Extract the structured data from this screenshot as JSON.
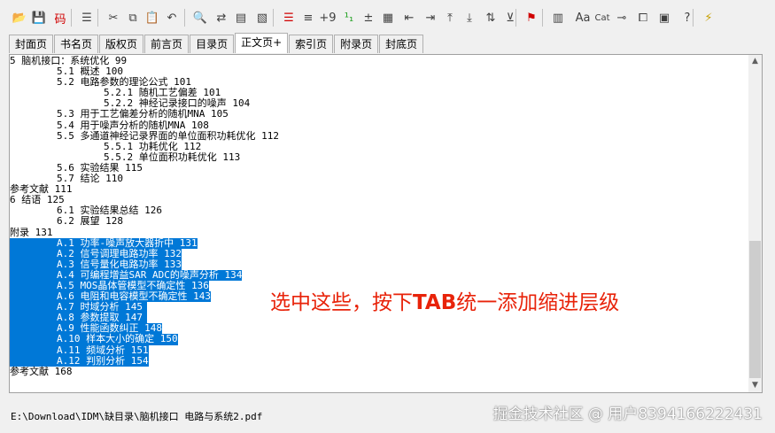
{
  "toolbar": {
    "items": [
      {
        "name": "open-folder-icon",
        "glyph": "📂",
        "color": "#c89a00"
      },
      {
        "name": "save-icon",
        "glyph": "💾",
        "color": "#404040"
      },
      {
        "name": "encoding-icon",
        "glyph": "码",
        "color": "#d00000"
      },
      {
        "name": "bookmark-panel-icon",
        "glyph": "☰",
        "color": "#404040"
      },
      {
        "name": "cut-icon",
        "glyph": "✂",
        "color": "#404040"
      },
      {
        "name": "copy-icon",
        "glyph": "⧉",
        "color": "#404040"
      },
      {
        "name": "paste-icon",
        "glyph": "📋",
        "color": "#404040"
      },
      {
        "name": "undo-icon",
        "glyph": "↶",
        "color": "#404040"
      },
      {
        "name": "find-icon",
        "glyph": "🔍",
        "color": "#404040"
      },
      {
        "name": "replace-icon",
        "glyph": "⇄",
        "color": "#404040"
      },
      {
        "name": "page-icon",
        "glyph": "▤",
        "color": "#404040"
      },
      {
        "name": "page-find-icon",
        "glyph": "▧",
        "color": "#404040"
      },
      {
        "name": "indent-level-icon",
        "glyph": "☰",
        "color": "#d00000"
      },
      {
        "name": "align-icon",
        "glyph": "≡",
        "color": "#404040"
      },
      {
        "name": "offset-icon",
        "glyph": "+9",
        "color": "#404040"
      },
      {
        "name": "numbering-icon",
        "glyph": "¹₁",
        "color": "#20a020"
      },
      {
        "name": "plus-minus-icon",
        "glyph": "±",
        "color": "#404040"
      },
      {
        "name": "document-icon",
        "glyph": "▦",
        "color": "#404040"
      },
      {
        "name": "outdent-icon",
        "glyph": "⇤",
        "color": "#404040"
      },
      {
        "name": "indent-icon",
        "glyph": "⇥",
        "color": "#404040"
      },
      {
        "name": "move-up-icon",
        "glyph": "⤒",
        "color": "#404040"
      },
      {
        "name": "move-down-icon",
        "glyph": "⤓",
        "color": "#404040"
      },
      {
        "name": "sort-icon",
        "glyph": "⇅",
        "color": "#404040"
      },
      {
        "name": "collapse-icon",
        "glyph": "⊻",
        "color": "#404040"
      },
      {
        "name": "pdf-icon",
        "glyph": "⚑",
        "color": "#d00000"
      },
      {
        "name": "columns-icon",
        "glyph": "▥",
        "color": "#404040"
      },
      {
        "name": "font-icon",
        "glyph": "Aa",
        "color": "#404040"
      },
      {
        "name": "category-icon",
        "glyph": "Cat",
        "color": "#404040"
      },
      {
        "name": "link-icon",
        "glyph": "⊸",
        "color": "#404040"
      },
      {
        "name": "window-icon",
        "glyph": "⧠",
        "color": "#404040"
      },
      {
        "name": "export-icon",
        "glyph": "▣",
        "color": "#404040"
      },
      {
        "name": "help-icon",
        "glyph": "?",
        "color": "#404040"
      },
      {
        "name": "settings-icon",
        "glyph": "⚡",
        "color": "#c8a000"
      }
    ]
  },
  "tabs": [
    "封面页",
    "书名页",
    "版权页",
    "前言页",
    "目录页",
    "正文页+",
    "索引页",
    "附录页",
    "封底页"
  ],
  "active_tab": 5,
  "lines": [
    {
      "text": "5 脑机接口：系统优化 99",
      "sel": false
    },
    {
      "text": "        5.1 概述 100",
      "sel": false
    },
    {
      "text": "        5.2 电路参数的理论公式 101",
      "sel": false
    },
    {
      "text": "                5.2.1 随机工艺偏差 101",
      "sel": false
    },
    {
      "text": "                5.2.2 神经记录接口的噪声 104",
      "sel": false
    },
    {
      "text": "        5.3 用于工艺偏差分析的随机MNA 105",
      "sel": false
    },
    {
      "text": "        5.4 用于噪声分析的随机MNA 108",
      "sel": false
    },
    {
      "text": "        5.5 多通道神经记录界面的单位面积功耗优化 112",
      "sel": false
    },
    {
      "text": "                5.5.1 功耗优化 112",
      "sel": false
    },
    {
      "text": "                5.5.2 单位面积功耗优化 113",
      "sel": false
    },
    {
      "text": "        5.6 实验结果 115",
      "sel": false
    },
    {
      "text": "        5.7 结论 110",
      "sel": false
    },
    {
      "text": "参考文献 111",
      "sel": false
    },
    {
      "text": "6 结语 125",
      "sel": false
    },
    {
      "text": "        6.1 实验结果总结 126",
      "sel": false
    },
    {
      "text": "        6.2 展望 128",
      "sel": false
    },
    {
      "text": "附录 131",
      "sel": false
    },
    {
      "text": "        A.1 功率-噪声放大器折中 131",
      "sel": true
    },
    {
      "text": "        A.2 信号调理电路功率 132",
      "sel": true
    },
    {
      "text": "        A.3 信号量化电路功率 133",
      "sel": true
    },
    {
      "text": "        A.4 可编程增益SAR ADC的噪声分析 134",
      "sel": true
    },
    {
      "text": "        A.5 MOS晶体管模型不确定性 136",
      "sel": true
    },
    {
      "text": "        A.6 电阻和电容模型不确定性 143",
      "sel": true
    },
    {
      "text": "        A.7 时域分析 145",
      "sel": true
    },
    {
      "text": "        A.8 参数提取 147",
      "sel": true
    },
    {
      "text": "        A.9 性能函数纠正 148",
      "sel": true
    },
    {
      "text": "        A.10 样本大小的确定 150",
      "sel": true
    },
    {
      "text": "        A.11 频域分析 151",
      "sel": true
    },
    {
      "text": "        A.12 判别分析 154",
      "sel": true
    },
    {
      "text": "参考文献 168",
      "sel": false
    }
  ],
  "annotation_parts": [
    "选中这些，按下",
    "TAB",
    "统一添加缩进层级"
  ],
  "status_path": "E:\\Download\\IDM\\缺目录\\脑机接口 电路与系统2.pdf",
  "watermark": "掘金技术社区 @ 用户8394166222431",
  "colors": {
    "selection": "#0078d7",
    "annotation": "#e8230a"
  }
}
